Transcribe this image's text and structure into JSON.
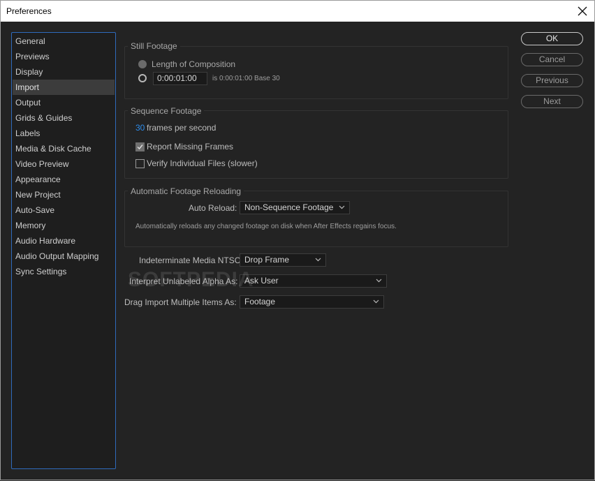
{
  "window": {
    "title": "Preferences"
  },
  "sidebar": {
    "items": [
      {
        "label": "General"
      },
      {
        "label": "Previews"
      },
      {
        "label": "Display"
      },
      {
        "label": "Import"
      },
      {
        "label": "Output"
      },
      {
        "label": "Grids & Guides"
      },
      {
        "label": "Labels"
      },
      {
        "label": "Media & Disk Cache"
      },
      {
        "label": "Video Preview"
      },
      {
        "label": "Appearance"
      },
      {
        "label": "New Project"
      },
      {
        "label": "Auto-Save"
      },
      {
        "label": "Memory"
      },
      {
        "label": "Audio Hardware"
      },
      {
        "label": "Audio Output Mapping"
      },
      {
        "label": "Sync Settings"
      }
    ],
    "selected": "Import"
  },
  "still_footage": {
    "title": "Still Footage",
    "length_option": "Length of Composition",
    "timecode_value": "0:00:01:00",
    "timecode_note": "is 0:00:01:00  Base 30"
  },
  "sequence_footage": {
    "title": "Sequence Footage",
    "fps_value": "30",
    "fps_label": "frames per second",
    "report_missing": "Report Missing Frames",
    "report_missing_checked": true,
    "verify_files": "Verify Individual Files (slower)",
    "verify_files_checked": false
  },
  "auto_reload": {
    "title": "Automatic Footage Reloading",
    "label": "Auto Reload:",
    "value": "Non-Sequence Footage",
    "note": "Automatically reloads any changed footage on disk when After Effects regains focus."
  },
  "ntsc": {
    "label": "Indeterminate Media NTSC:",
    "value": "Drop Frame"
  },
  "alpha": {
    "label": "Interpret Unlabeled Alpha As:",
    "value": "Ask User"
  },
  "drag_import": {
    "label": "Drag Import Multiple Items As:",
    "value": "Footage"
  },
  "buttons": {
    "ok": "OK",
    "cancel": "Cancel",
    "previous": "Previous",
    "next": "Next"
  },
  "watermark": "SOFTPEDIA",
  "colors": {
    "accent_blue": "#2d8ceb",
    "sidebar_border": "#2f6bbd",
    "background": "#232323"
  }
}
